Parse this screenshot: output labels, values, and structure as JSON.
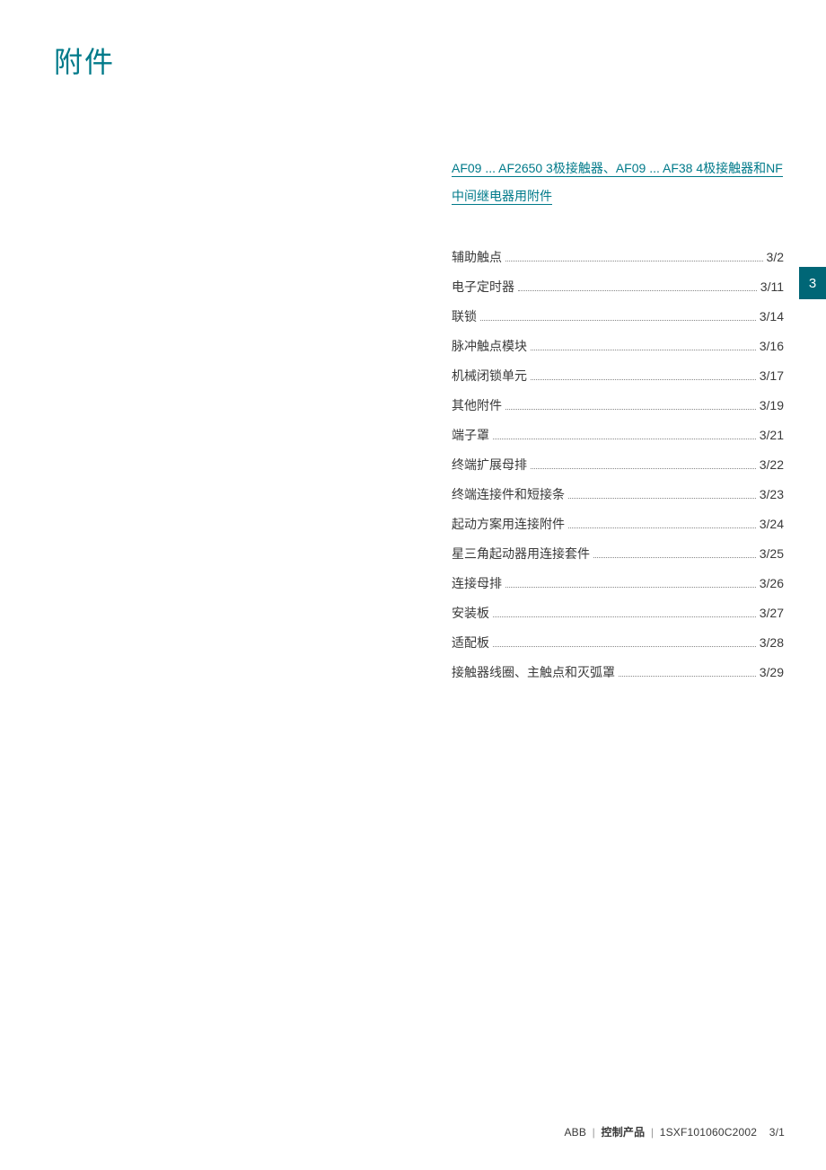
{
  "title": "附件",
  "section_header": "AF09 ... AF2650 3极接触器、AF09 ... AF38 4极接触器和NF中间继电器用附件",
  "toc": [
    {
      "label": "辅助触点",
      "page": "3/2"
    },
    {
      "label": "电子定时器",
      "page": "3/11"
    },
    {
      "label": "联锁",
      "page": "3/14"
    },
    {
      "label": "脉冲触点模块",
      "page": "3/16"
    },
    {
      "label": "机械闭锁单元",
      "page": "3/17"
    },
    {
      "label": "其他附件",
      "page": "3/19"
    },
    {
      "label": "端子罩",
      "page": "3/21"
    },
    {
      "label": "终端扩展母排",
      "page": "3/22"
    },
    {
      "label": "终端连接件和短接条",
      "page": "3/23"
    },
    {
      "label": "起动方案用连接附件",
      "page": "3/24"
    },
    {
      "label": "星三角起动器用连接套件",
      "page": "3/25"
    },
    {
      "label": "连接母排",
      "page": "3/26"
    },
    {
      "label": "安装板",
      "page": "3/27"
    },
    {
      "label": "适配板",
      "page": "3/28"
    },
    {
      "label": "接触器线圈、主触点和灭弧罩",
      "page": "3/29"
    }
  ],
  "side_tab": "3",
  "footer": {
    "brand": "ABB",
    "category": "控制产品",
    "doc_id": "1SXF101060C2002",
    "page_number": "3/1"
  }
}
